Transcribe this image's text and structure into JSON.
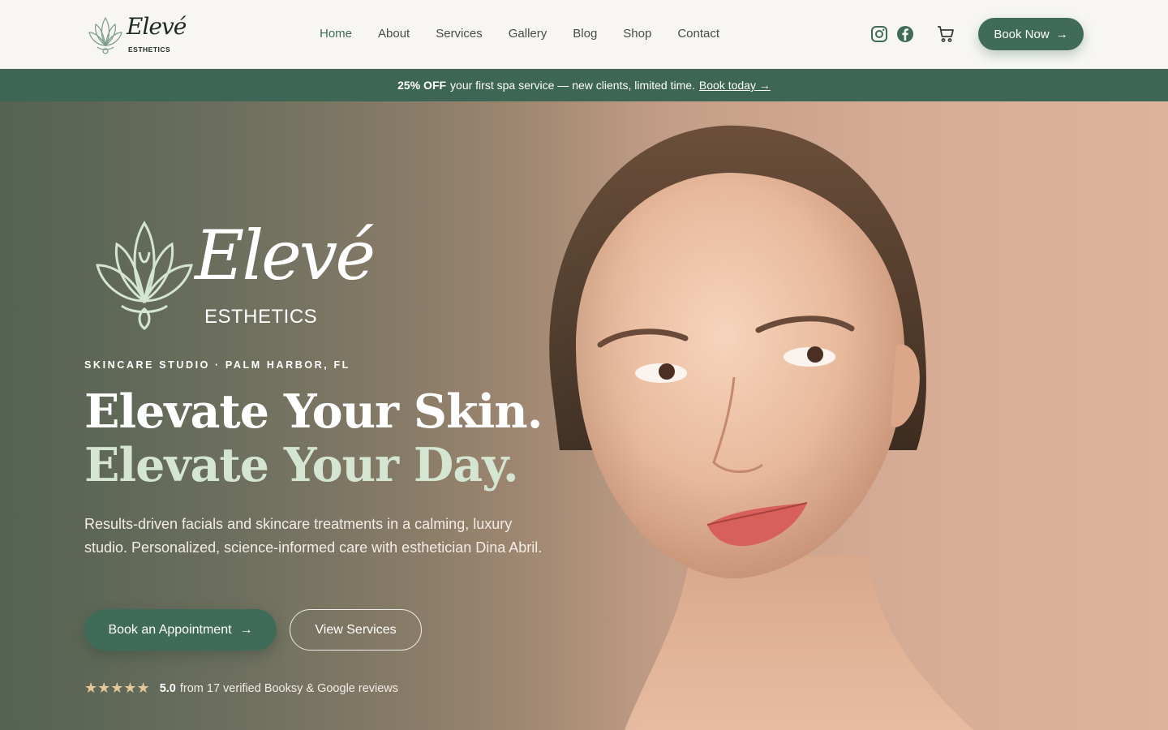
{
  "header": {
    "logo_script": "Elevé",
    "logo_sub": "ESTHETICS",
    "nav": [
      "Home",
      "About",
      "Services",
      "Gallery",
      "Blog",
      "Shop",
      "Contact"
    ],
    "active_nav": "Home",
    "icons": [
      "instagram-icon",
      "facebook-icon",
      "cart-icon"
    ],
    "book_now": "Book Now",
    "accent_color": "#3f6b58"
  },
  "promo": {
    "bold": "25% OFF",
    "text": "your first spa service — new clients, limited time.",
    "link": "Book today →"
  },
  "hero": {
    "logo_script": "Elevé",
    "logo_sub": "ESTHETICS",
    "eyebrow": "SKINCARE STUDIO · PALM HARBOR, FL",
    "headline_1": "Elevate Your Skin.",
    "headline_2": "Elevate Your Day.",
    "description": "Results-driven facials and skincare treatments in a calming, luxury studio. Personalized, science-informed care with esthetician Dina Abril.",
    "primary_cta": "Book an Appointment",
    "secondary_cta": "View Services",
    "stars": "★★★★★",
    "rating_value": "5.0",
    "rating_text": "from 17 verified Booksy & Google reviews"
  }
}
